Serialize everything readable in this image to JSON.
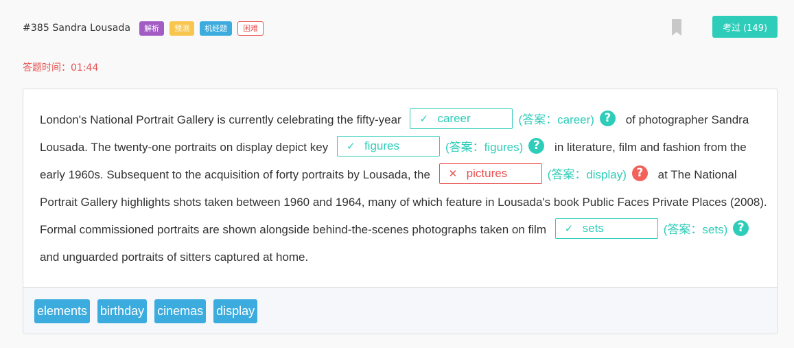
{
  "header": {
    "title": "#385 Sandra Lousada",
    "tags": [
      "解析",
      "预测",
      "机经题",
      "困难"
    ],
    "pass_button": "考过 (149)"
  },
  "timer": "答题时间：01:44",
  "passage": {
    "seg1": "London's National Portrait Gallery is currently celebrating the fifty-year",
    "blank1": {
      "value": "career",
      "answer": "(答案：career)",
      "correct": true
    },
    "seg2": "of photographer Sandra Lousada. The twenty-one portraits on display depict key",
    "blank2": {
      "value": "figures",
      "answer": "(答案：figures)",
      "correct": true
    },
    "seg3": "in literature, film and fashion from the early 1960s. Subsequent to the acquisition of forty portraits by Lousada, the",
    "blank3": {
      "value": "pictures",
      "answer": "(答案：display)",
      "correct": false
    },
    "seg4": "at The National Portrait Gallery highlights shots taken between 1960 and 1964, many of which feature in Lousada's book Public Faces Private Places (2008). Formal commissioned portraits are shown alongside behind-the-scenes photographs taken on film",
    "blank4": {
      "value": "sets",
      "answer": "(答案：sets)",
      "correct": true
    },
    "seg5": "and unguarded portraits of sitters captured at home."
  },
  "icons": {
    "correct_mark": "✓",
    "wrong_mark": "✕",
    "help": "?"
  },
  "word_bank": [
    "elements",
    "birthday",
    "cinemas",
    "display"
  ],
  "colors": {
    "accent": "#2ecdb9",
    "error": "#e8504f",
    "word_chip": "#3cacde"
  }
}
